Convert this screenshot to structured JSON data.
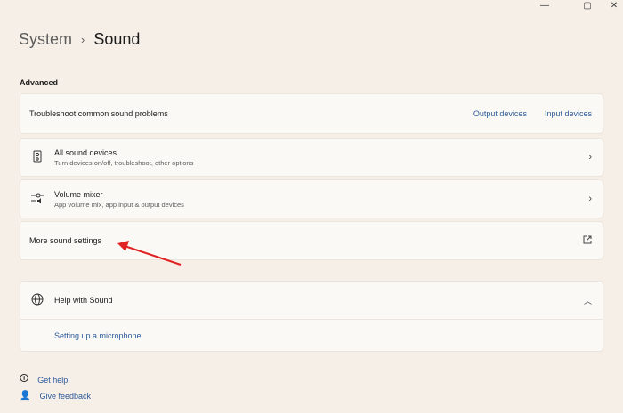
{
  "window": {
    "minimize": "—",
    "maximize": "▢",
    "close": "✕"
  },
  "breadcrumb": {
    "parent": "System",
    "separator": "›",
    "current": "Sound"
  },
  "section": "Advanced",
  "troubleshoot": {
    "label": "Troubleshoot common sound problems",
    "links": [
      "Output devices",
      "Input devices"
    ]
  },
  "all_devices": {
    "title": "All sound devices",
    "subtitle": "Turn devices on/off, troubleshoot, other options"
  },
  "volume_mixer": {
    "title": "Volume mixer",
    "subtitle": "App volume mix, app input & output devices"
  },
  "more_settings": {
    "title": "More sound settings"
  },
  "help": {
    "title": "Help with Sound",
    "link": "Setting up a microphone"
  },
  "footer": {
    "get_help": "Get help",
    "feedback": "Give feedback"
  },
  "colors": {
    "annotation_arrow": "#e02424",
    "link": "#2c5a9a"
  }
}
